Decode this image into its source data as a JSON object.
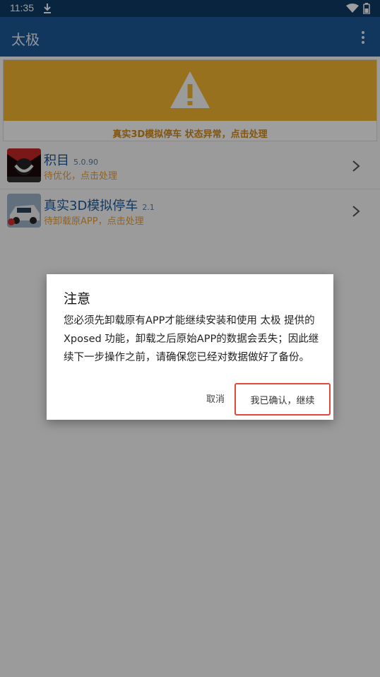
{
  "status_bar": {
    "time": "11:35"
  },
  "app_bar": {
    "title": "太极"
  },
  "warning_card": {
    "text": "真实3D模拟停车 状态异常，点击处理"
  },
  "apps": [
    {
      "name": "积目",
      "version": "5.0.90",
      "status": "待优化，点击处理"
    },
    {
      "name": "真实3D模拟停车",
      "version": "2.1",
      "status": "待卸载原APP，点击处理"
    }
  ],
  "dialog": {
    "title": "注意",
    "message": "您必须先卸载原有APP才能继续安装和使用 太极 提供的 Xposed 功能，卸载之后原始APP的数据会丢失；因此继续下一步操作之前，请确保您已经对数据做好了备份。",
    "cancel_label": "取消",
    "confirm_label": "我已确认，继续"
  },
  "colors": {
    "primary": "#1c5a99",
    "status_bar": "#0f3a66",
    "warning": "#f5b731",
    "highlight": "#e04a3c"
  }
}
